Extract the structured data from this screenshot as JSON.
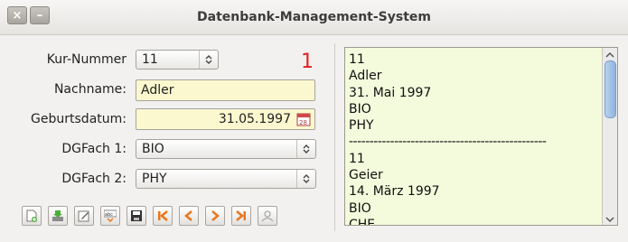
{
  "window": {
    "title": "Datenbank-Management-System",
    "close_glyph": "×",
    "min_glyph": "–"
  },
  "form": {
    "kurs_label": "Kur-Nummer",
    "kurs_value": "11",
    "counter": "1",
    "nachname_label": "Nachname:",
    "nachname_value": "Adler",
    "geburtsdatum_label": "Geburtsdatum:",
    "geburtsdatum_value": "31.05.1997",
    "dgfach1_label": "DGFach 1:",
    "dgfach1_value": "BIO",
    "dgfach2_label": "DGFach 2:",
    "dgfach2_value": "PHY"
  },
  "toolbar": {
    "icons": [
      "new-record-icon",
      "import-icon",
      "edit-icon",
      "spellcheck-icon",
      "save-icon",
      "first-record-icon",
      "previous-record-icon",
      "next-record-icon",
      "last-record-icon",
      "user-icon"
    ]
  },
  "output": {
    "lines": [
      "11",
      "Adler",
      "31. Mai 1997",
      "BIO",
      "PHY",
      "------------------------------------------------",
      "11",
      "Geier",
      "14. März 1997",
      "BIO",
      "CHE"
    ]
  },
  "colors": {
    "field_bg": "#fbf8cf",
    "output_bg": "#f4fbdc",
    "counter": "#e02020",
    "nav_arrow": "#e8771e"
  }
}
